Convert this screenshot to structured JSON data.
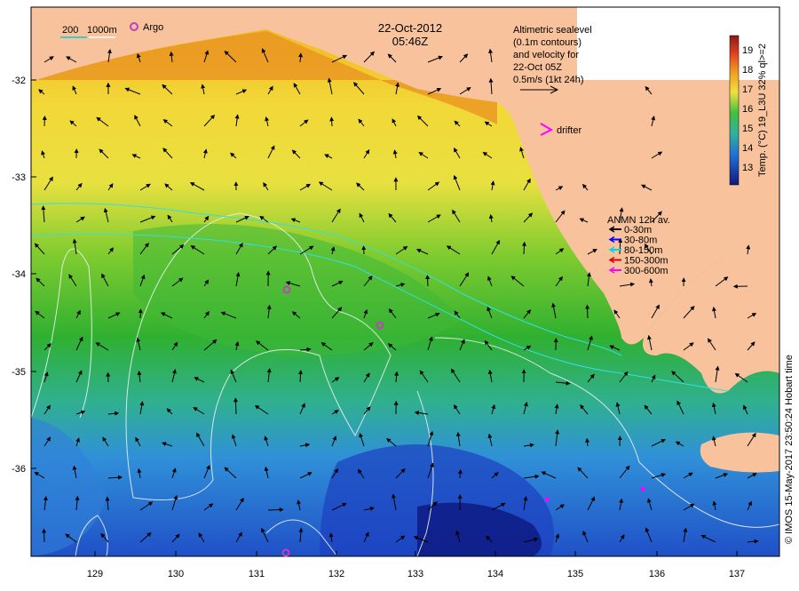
{
  "map": {
    "date": "22-Oct-2012",
    "time": "05:46Z",
    "scale_label_1": "200",
    "scale_label_2": "1000m",
    "argo_label": "Argo",
    "drifter_label": "drifter",
    "altimetry_lines": [
      "Altimetric sealevel",
      "(0.1m contours)",
      "and velocity for",
      "22-Oct 05Z"
    ],
    "speed_label": "0.5m/s (1kt 24h)",
    "credit": "© IMOS 15-May-2017 23:50:24 Hobart time"
  },
  "axes": {
    "x_ticks": [
      "129",
      "130",
      "131",
      "132",
      "133",
      "134",
      "135",
      "136",
      "137"
    ],
    "y_ticks": [
      "-32",
      "-33",
      "-34",
      "-35",
      "-36"
    ]
  },
  "colorbar": {
    "title": "Temp. (°C) 19_L3U 32% ql>=2",
    "ticks": [
      "19",
      "18",
      "17",
      "16",
      "15",
      "14",
      "13"
    ]
  },
  "legend": {
    "title": "ANMN 12h av.",
    "items": [
      {
        "label": "0-30m",
        "color": "#000000"
      },
      {
        "label": "30-80m",
        "color": "#0000ff"
      },
      {
        "label": "80-150m",
        "color": "#00d8e8"
      },
      {
        "label": "150-300m",
        "color": "#e00000"
      },
      {
        "label": "300-600m",
        "color": "#ff00ff"
      }
    ]
  },
  "colors": {
    "land": "#f8c39c",
    "warm": "#f2b020",
    "yellow": "#f0e040",
    "green": "#40c040",
    "cyan": "#40b8d8",
    "blue": "#2060d8",
    "deep": "#101890",
    "argo": "#c040c0",
    "drifter": "#ff00ff"
  }
}
